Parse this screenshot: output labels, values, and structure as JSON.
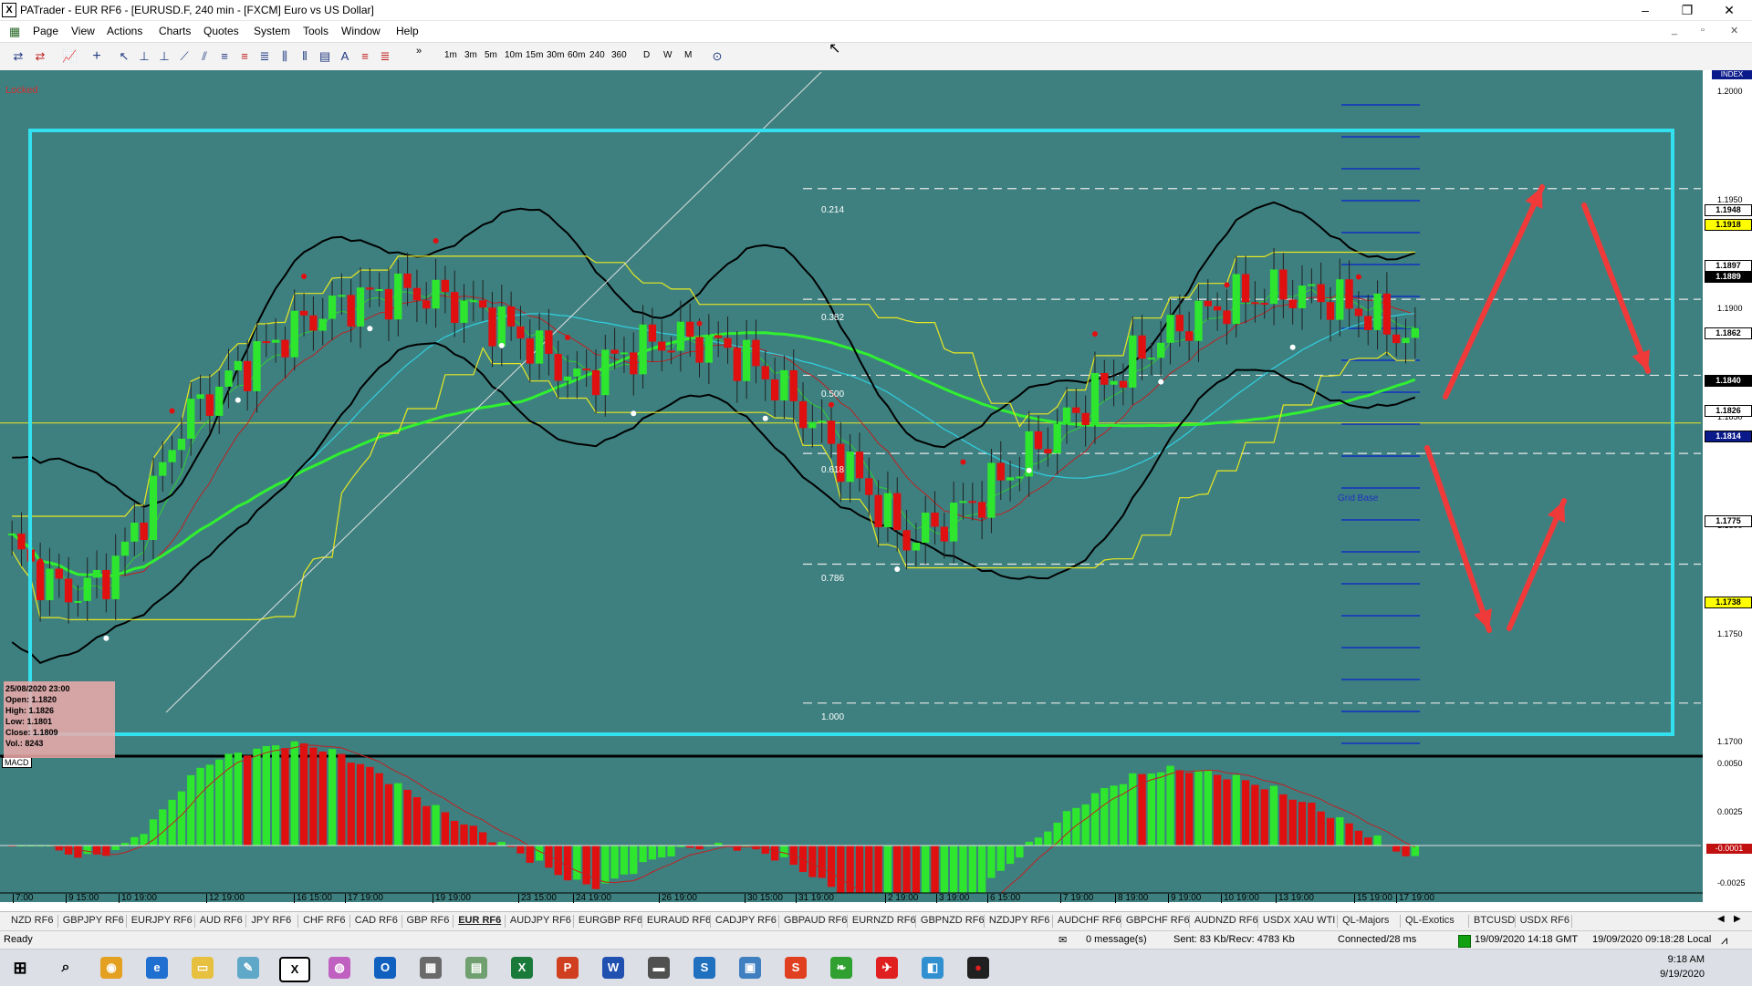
{
  "window": {
    "title": "PATrader - EUR RF6 - [EURUSD.F, 240 min - [FXCM] Euro vs US Dollar]",
    "logo": "X",
    "minimize": "–",
    "restore": "❐",
    "close": "✕"
  },
  "menu": [
    "Page",
    "View",
    "Actions",
    "Charts",
    "Quotes",
    "System",
    "Tools",
    "Window",
    "Help"
  ],
  "toolbar": {
    "timeframes": [
      "1m",
      "3m",
      "5m",
      "10m",
      "15m",
      "30m",
      "60m",
      "240",
      "360",
      "D",
      "W",
      "M"
    ],
    "more": "»"
  },
  "chart": {
    "status": "Locked",
    "index_label": "INDEX",
    "macd_label": "MACD",
    "grid_base_label": "Grid Base",
    "data_window": {
      "date": "25/08/2020 23:00",
      "open": "Open: 1.1820",
      "high": "High: 1.1826",
      "low": "Low: 1.1801",
      "close": "Close: 1.1809",
      "vol": "Vol.: 8243"
    },
    "fib_labels": [
      "0.214",
      "0.382",
      "0.500",
      "0.618",
      "0.786",
      "1.000"
    ],
    "price_ticks": [
      "1.2000",
      "1.1950",
      "1.1900",
      "1.1850",
      "1.1800",
      "1.1750",
      "1.1700"
    ],
    "price_markers": [
      {
        "label": "1.1948",
        "bg": "#ffffff",
        "fg": "#000000"
      },
      {
        "label": "1.1918",
        "bg": "#ffff00",
        "fg": "#000000"
      },
      {
        "label": "1.1897",
        "bg": "#ffffff",
        "fg": "#000000"
      },
      {
        "label": "1.1889",
        "bg": "#000000",
        "fg": "#ffffff"
      },
      {
        "label": "1.1862",
        "bg": "#ffffff",
        "fg": "#000000"
      },
      {
        "label": "1.1840",
        "bg": "#000000",
        "fg": "#ffffff"
      },
      {
        "label": "1.1826",
        "bg": "#ffffff",
        "fg": "#000000"
      },
      {
        "label": "1.1814",
        "bg": "#0a1a8a",
        "fg": "#ffffff"
      },
      {
        "label": "1.1775",
        "bg": "#ffffff",
        "fg": "#000000"
      },
      {
        "label": "1.1738",
        "bg": "#ffff00",
        "fg": "#000000"
      }
    ],
    "macd_ticks": [
      "0.0050",
      "0.0025",
      "-0.0001",
      "-0.0025"
    ],
    "time_labels": [
      "7:00",
      "9 15:00",
      "10 19:00",
      "12 19:00",
      "16 15:00",
      "17 19:00",
      "19 19:00",
      "23 15:00",
      "24 19:00",
      "26 19:00",
      "30 15:00",
      "31 19:00",
      "2 19:00",
      "3 19:00",
      "6 15:00",
      "7 19:00",
      "8 19:00",
      "9 19:00",
      "10 19:00",
      "13 19:00",
      "15 19:00",
      "17 19:00"
    ]
  },
  "tabs": [
    "NZD RF6",
    "GBPJPY RF6",
    "EURJPY RF6",
    "AUD RF6",
    "JPY RF6",
    "CHF RF6",
    "CAD RF6",
    "GBP RF6",
    "EUR RF6",
    "AUDJPY RF6",
    "EURGBP RF6",
    "EURAUD RF6",
    "CADJPY RF6",
    "GBPAUD RF6",
    "EURNZD RF6",
    "GBPNZD RF6",
    "NZDJPY RF6",
    "AUDCHF RF6",
    "GBPCHF RF6",
    "AUDNZD RF6",
    "USDX XAU WTI",
    "QL-Majors",
    "QL-Exotics",
    "BTCUSD",
    "USDX RF6"
  ],
  "active_tab": "EUR RF6",
  "status": {
    "ready": "Ready",
    "messages": "0 message(s)",
    "traffic": "Sent: 83 Kb/Recv: 4783 Kb",
    "connection": "Connected/28 ms",
    "gmt": "19/09/2020 14:18 GMT",
    "local": "19/09/2020 09:18:28 Local"
  },
  "taskbar": {
    "time": "9:18 AM",
    "date": "9/19/2020"
  },
  "colors": {
    "chart_bg": "#3e8080",
    "up_candle": "#2ee62e",
    "down_candle": "#e01010",
    "box": "#33e0f0",
    "arrow": "#f03a3a"
  }
}
